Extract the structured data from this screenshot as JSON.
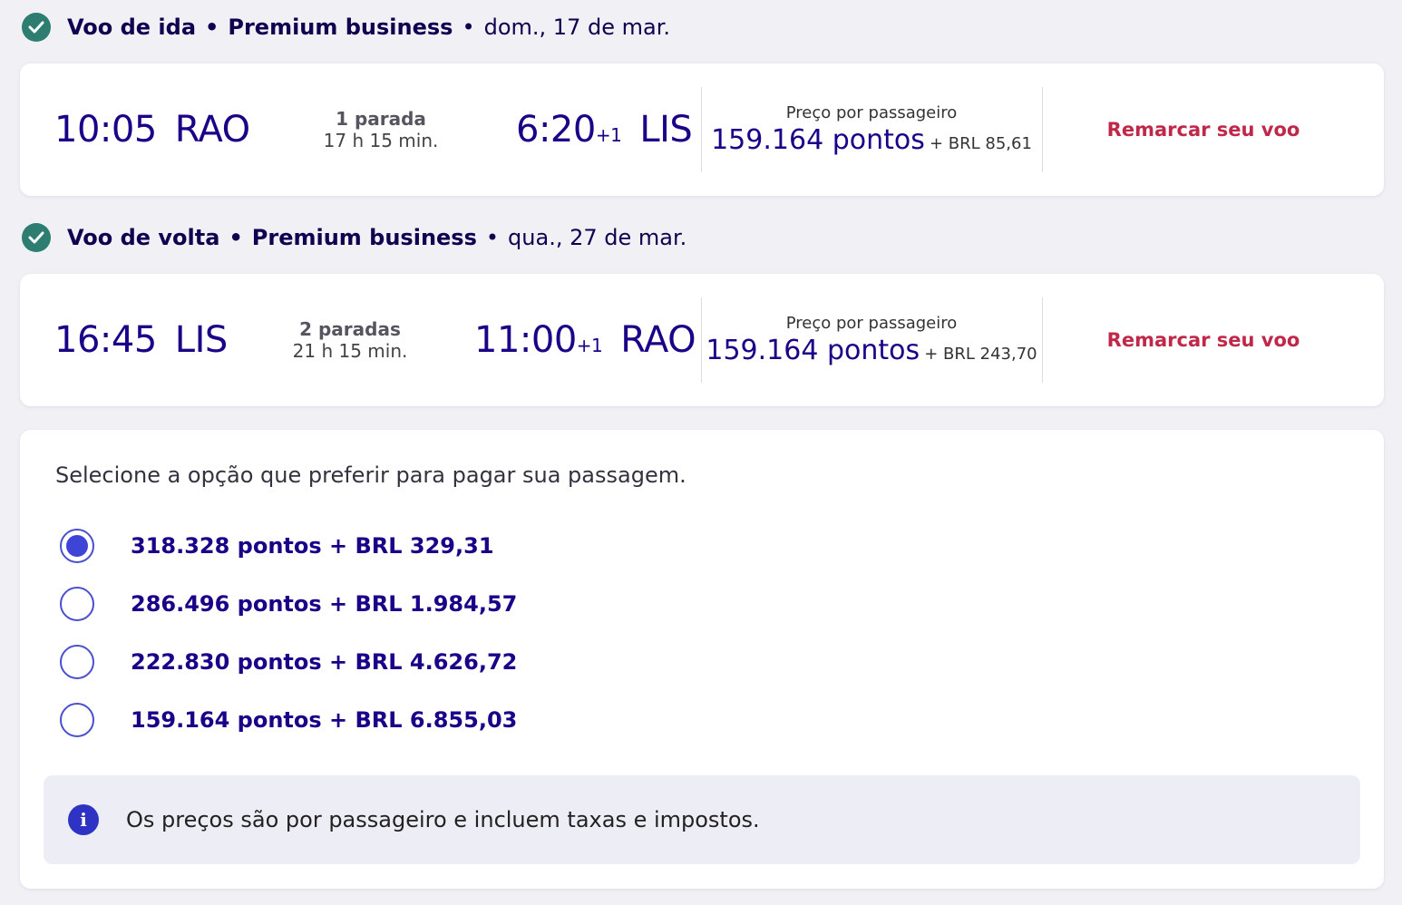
{
  "outbound": {
    "header": {
      "label": "Voo de ida",
      "dot1": "•",
      "cabin": "Premium business",
      "dot2": "•",
      "date": "dom., 17 de mar."
    },
    "dep_time": "10:05",
    "dep_station": "RAO",
    "stops": "1 parada",
    "duration": "17 h 15 min.",
    "arr_time": "6:20",
    "arr_plus": "+1",
    "arr_station": "LIS",
    "price_label": "Preço por passageiro",
    "price_points": "159.164 pontos",
    "price_tax": "+ BRL 85,61",
    "rebook_label": "Remarcar seu voo"
  },
  "return": {
    "header": {
      "label": "Voo de volta",
      "dot1": "•",
      "cabin": "Premium business",
      "dot2": "•",
      "date": "qua., 27 de mar."
    },
    "dep_time": "16:45",
    "dep_station": "LIS",
    "stops": "2 paradas",
    "duration": "21 h 15 min.",
    "arr_time": "11:00",
    "arr_plus": "+1",
    "arr_station": "RAO",
    "price_label": "Preço por passageiro",
    "price_points": "159.164 pontos",
    "price_tax": "+ BRL 243,70",
    "rebook_label": "Remarcar seu voo"
  },
  "payment": {
    "title": "Selecione a opção que preferir para pagar sua passagem.",
    "options": [
      {
        "label": "318.328 pontos + BRL 329,31",
        "selected": true
      },
      {
        "label": "286.496 pontos + BRL 1.984,57",
        "selected": false
      },
      {
        "label": "222.830 pontos + BRL 4.626,72",
        "selected": false
      },
      {
        "label": "159.164 pontos + BRL 6.855,03",
        "selected": false
      }
    ],
    "info_icon": "info-icon",
    "info_icon_glyph": "i",
    "info_text": "Os preços são por passageiro e incluem taxas e impostos."
  },
  "colors": {
    "primary": "#1b0088",
    "accent_red": "#c0284a",
    "check_green": "#2e7d71",
    "radio_blue": "#3d44d6"
  }
}
